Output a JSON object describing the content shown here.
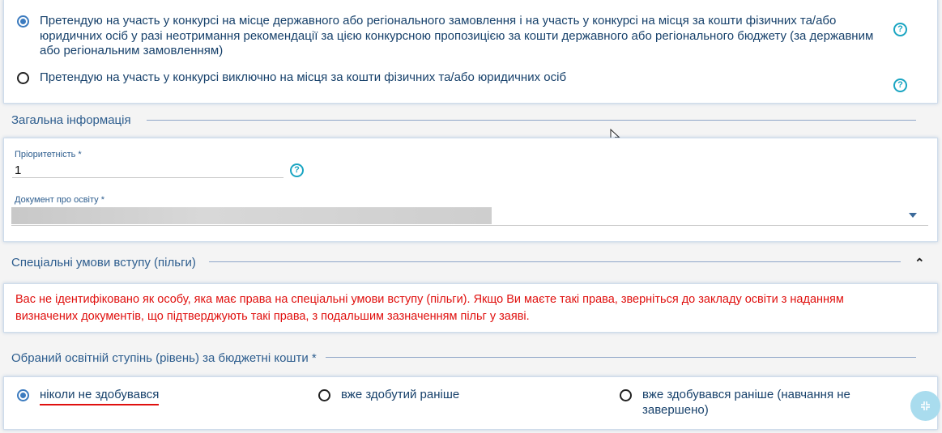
{
  "funding_options": [
    {
      "label": "Претендую на участь у конкурсі на місце державного або регіонального замовлення і на участь у конкурсі на місця за кошти фізичних та/або юридичних осіб у разі неотримання рекомендації за цією конкурсною пропозицією за кошти державного або регіонального бюджету (за державним або регіональним замовленням)",
      "checked": true
    },
    {
      "label": "Претендую на участь у конкурсі виключно на місця за кошти фізичних та/або юридичних осіб",
      "checked": false
    }
  ],
  "help_glyph": "?",
  "general": {
    "title": "Загальна інформація",
    "priority_label": "Пріоритетність *",
    "priority_value": "1",
    "document_label": "Документ про освіту *"
  },
  "special": {
    "title": "Спеціальні умови вступу (пільги)",
    "collapse_glyph": "⌃",
    "warning": "Вас не ідентифіковано як особу, яка має права на спеціальні умови вступу (пільги). Якщо Ви маєте такі права, зверніться до закладу освіти з наданням визначених документів, що підтверджують такі права, з подальшим зазначенням пільг у заяві."
  },
  "degree": {
    "title": "Обраний освітній ступінь (рівень) за бюджетні кошти *",
    "options": [
      {
        "label": "ніколи не здобувався",
        "checked": true
      },
      {
        "label": "вже здобутий раніше",
        "checked": false
      },
      {
        "label": "вже здобувався раніше (навчання не завершено)",
        "checked": false
      }
    ]
  },
  "colors": {
    "accent": "#3c7bbf",
    "help": "#1aa5c2",
    "warning": "#e0100e",
    "fab": "#a9dcee"
  }
}
